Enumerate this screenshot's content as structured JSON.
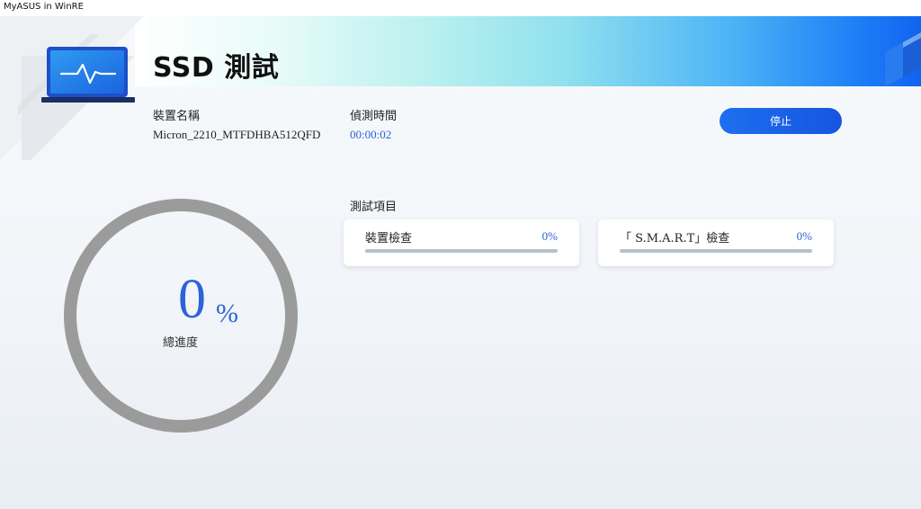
{
  "window": {
    "title": "MyASUS in WinRE"
  },
  "header": {
    "title": "SSD 測試"
  },
  "device": {
    "name_label": "裝置名稱",
    "name_value": "Micron_2210_MTFDHBA512QFD"
  },
  "timer": {
    "label": "偵測時間",
    "value": "00:00:02"
  },
  "actions": {
    "stop_label": "停止"
  },
  "overall": {
    "percent_value": "0",
    "percent_sign": "%",
    "label": "總進度",
    "fraction": 0
  },
  "tests": {
    "section_label": "測試項目",
    "items": [
      {
        "name": "裝置檢查",
        "percent": "0%",
        "fraction": 0
      },
      {
        "name": "「 S.M.A.R.T」檢查",
        "percent": "0%",
        "fraction": 0
      }
    ]
  },
  "colors": {
    "accent": "#2e63d6",
    "button": "#1d6ff0",
    "ring_track": "#9b9b9b",
    "bar_track": "#b7c1c9"
  },
  "icons": [
    "laptop-health-icon"
  ]
}
